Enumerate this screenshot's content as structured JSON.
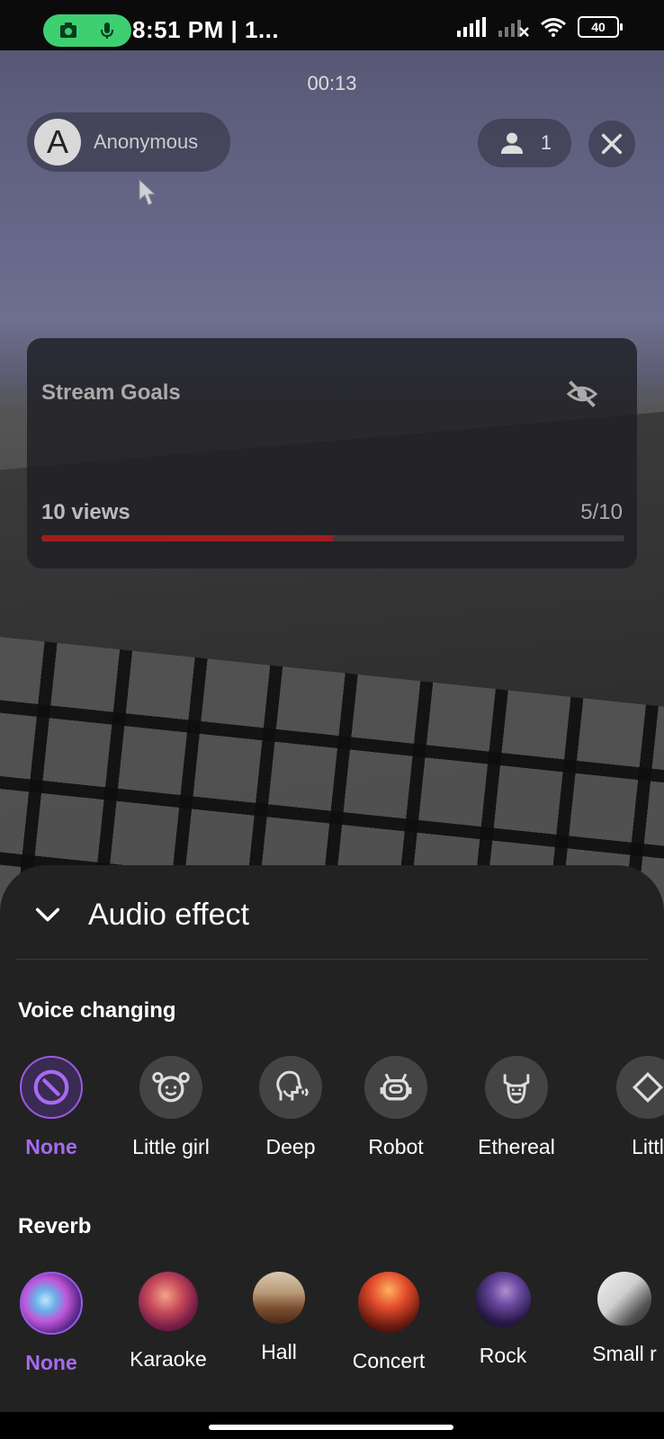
{
  "status_bar": {
    "time": "8:51 PM | 1...",
    "battery": "40"
  },
  "stream": {
    "timer": "00:13",
    "user": {
      "initial": "A",
      "name": "Anonymous"
    },
    "viewers": "1"
  },
  "goals": {
    "title": "Stream Goals",
    "label": "10 views",
    "count": "5/10",
    "progress": 0.5
  },
  "sheet": {
    "title": "Audio effect",
    "voice_section": "Voice changing",
    "voice_options": [
      {
        "label": "None",
        "icon": "no-effect-icon",
        "selected": true
      },
      {
        "label": "Little girl",
        "icon": "girl-face-icon"
      },
      {
        "label": "Deep",
        "icon": "deep-voice-icon"
      },
      {
        "label": "Robot",
        "icon": "robot-icon"
      },
      {
        "label": "Ethereal",
        "icon": "ethereal-icon"
      },
      {
        "label": "Littl",
        "icon": "little-icon"
      }
    ],
    "reverb_section": "Reverb",
    "reverb_options": [
      {
        "label": "None",
        "selected": true
      },
      {
        "label": "Karaoke"
      },
      {
        "label": "Hall"
      },
      {
        "label": "Concert"
      },
      {
        "label": "Rock"
      },
      {
        "label": "Small r"
      }
    ]
  },
  "colors": {
    "accent": "#9b59e6",
    "progress": "#a11d1d",
    "sheet_bg": "#222222"
  }
}
